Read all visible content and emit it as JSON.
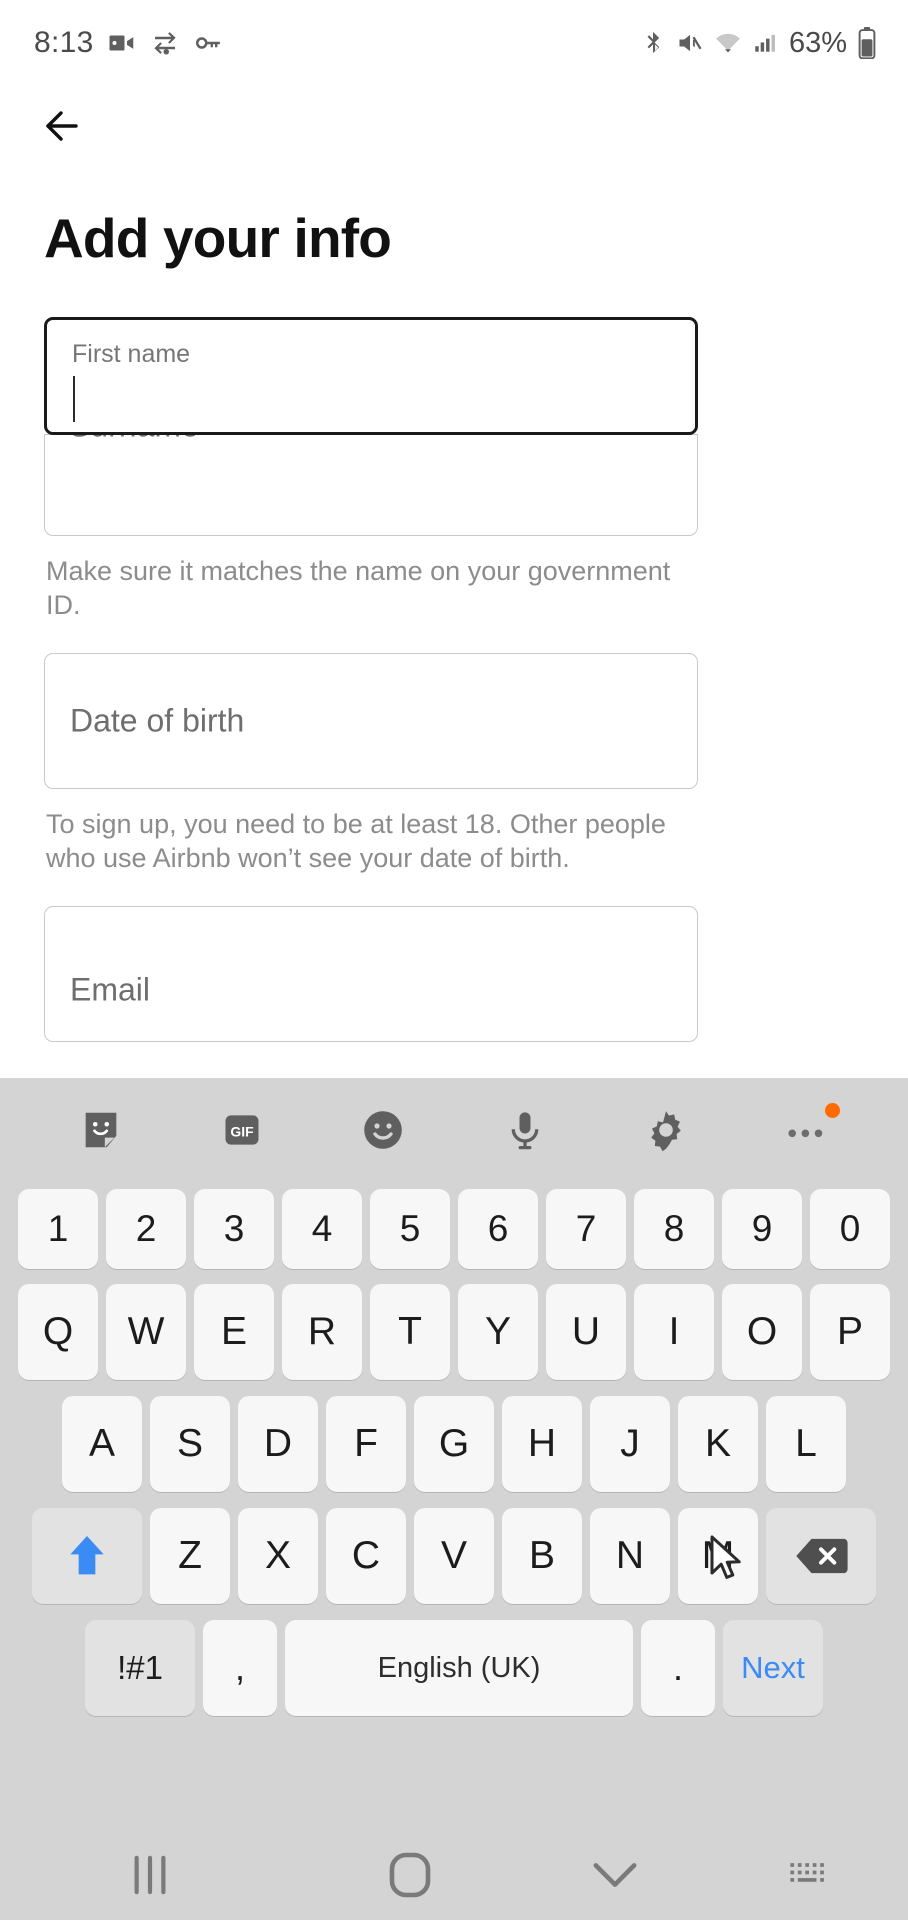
{
  "status_bar": {
    "time": "8:13",
    "battery_percent": "63%",
    "left_icons": [
      "camera-recording-icon",
      "vpn-key-sync-icon",
      "key-icon"
    ],
    "right_icons": [
      "bluetooth-icon",
      "mute-icon",
      "wifi-icon",
      "cellular-signal-icon",
      "battery-icon"
    ]
  },
  "app": {
    "back_label": "Back",
    "title": "Add your info"
  },
  "form": {
    "first_name": {
      "label": "First name",
      "value": "",
      "focused": true
    },
    "surname": {
      "placeholder": "Surname",
      "value": ""
    },
    "name_helper": "Make sure it matches the name on your government ID.",
    "date_of_birth": {
      "placeholder": "Date of birth",
      "value": ""
    },
    "dob_helper": "To sign up, you need to be at least 18. Other people who use Airbnb won’t see your date of birth.",
    "email": {
      "placeholder": "Email",
      "value": ""
    }
  },
  "keyboard": {
    "toolbar": [
      {
        "name": "sticker-icon",
        "label": ""
      },
      {
        "name": "gif-icon",
        "label": "GIF"
      },
      {
        "name": "emoji-icon",
        "label": ""
      },
      {
        "name": "microphone-icon",
        "label": ""
      },
      {
        "name": "gear-icon",
        "label": ""
      },
      {
        "name": "more-options-icon",
        "label": ""
      }
    ],
    "row_numbers": [
      "1",
      "2",
      "3",
      "4",
      "5",
      "6",
      "7",
      "8",
      "9",
      "0"
    ],
    "row_top": [
      "Q",
      "W",
      "E",
      "R",
      "T",
      "Y",
      "U",
      "I",
      "O",
      "P"
    ],
    "row_home": [
      "A",
      "S",
      "D",
      "F",
      "G",
      "H",
      "J",
      "K",
      "L"
    ],
    "row_bottom": [
      "Z",
      "X",
      "C",
      "V",
      "B",
      "N",
      "M"
    ],
    "shift_label": "",
    "backspace_label": "",
    "symbols_label": "!#1",
    "comma_label": ",",
    "space_label": "English (UK)",
    "period_label": ".",
    "action_label": "Next",
    "shift_active_color": "#3b8bf5",
    "action_color": "#3b8bf5"
  },
  "nav_bar": {
    "recents": "recents-icon",
    "home": "home-icon",
    "hide_keyboard": "chevron-down-icon",
    "switch_keyboard": "keyboard-switch-icon"
  }
}
